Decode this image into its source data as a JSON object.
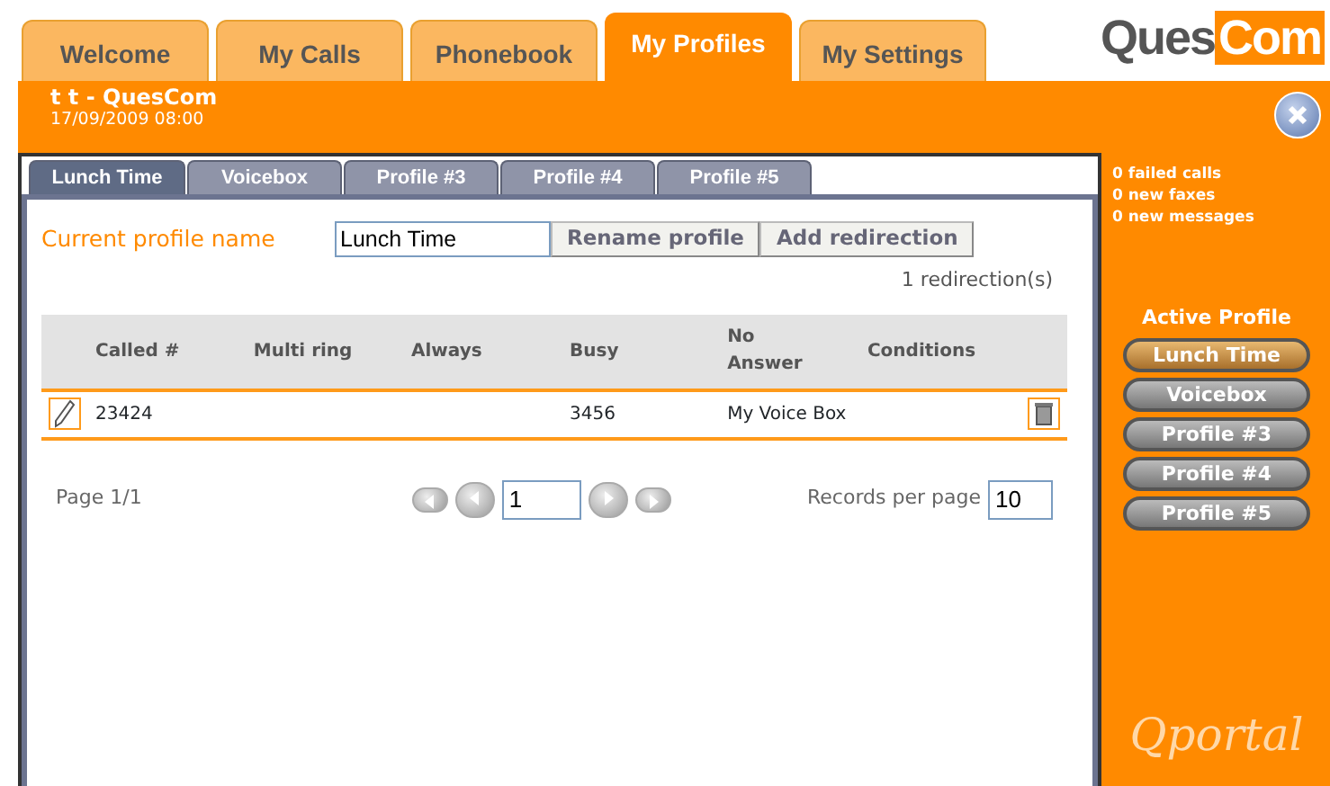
{
  "logo": {
    "part_1": "Ques",
    "part_2": "Com"
  },
  "main_tabs": [
    {
      "label": "Welcome",
      "selected": false
    },
    {
      "label": "My Calls",
      "selected": false
    },
    {
      "label": "Phonebook",
      "selected": false
    },
    {
      "label": "My Profiles",
      "selected": true
    },
    {
      "label": "My Settings",
      "selected": false
    }
  ],
  "header": {
    "user": "t t - QuesCom",
    "datetime": "17/09/2009 08:00"
  },
  "profile_tabs": [
    {
      "label": "Lunch Time",
      "selected": true
    },
    {
      "label": "Voicebox",
      "selected": false
    },
    {
      "label": "Profile #3",
      "selected": false
    },
    {
      "label": "Profile #4",
      "selected": false
    },
    {
      "label": "Profile #5",
      "selected": false
    }
  ],
  "profile_form": {
    "label": "Current profile name",
    "value": "Lunch Time",
    "buttons": [
      "Rename profile",
      "Add redirection"
    ],
    "count": "1 redirection(s)"
  },
  "table": {
    "columns": [
      "Called #",
      "Multi ring",
      "Always",
      "Busy",
      "No Answer",
      "Conditions"
    ],
    "rows": [
      {
        "cells": [
          "23424",
          null,
          null,
          "3456",
          "My Voice Box",
          null
        ]
      }
    ]
  },
  "pager": {
    "page": "Page 1/1",
    "page_value": "1",
    "records_label": "Records per page",
    "records_value": "10"
  },
  "stats": [
    "0 failed calls",
    "0 new faxes",
    "0 new messages"
  ],
  "active_profile": {
    "title": "Active Profile",
    "profiles": [
      {
        "label": "Lunch Time",
        "selected": true
      },
      {
        "label": "Voicebox",
        "selected": false
      },
      {
        "label": "Profile #3",
        "selected": false
      },
      {
        "label": "Profile #4",
        "selected": false
      },
      {
        "label": "Profile #5",
        "selected": false
      }
    ]
  },
  "brand": "Qportal"
}
